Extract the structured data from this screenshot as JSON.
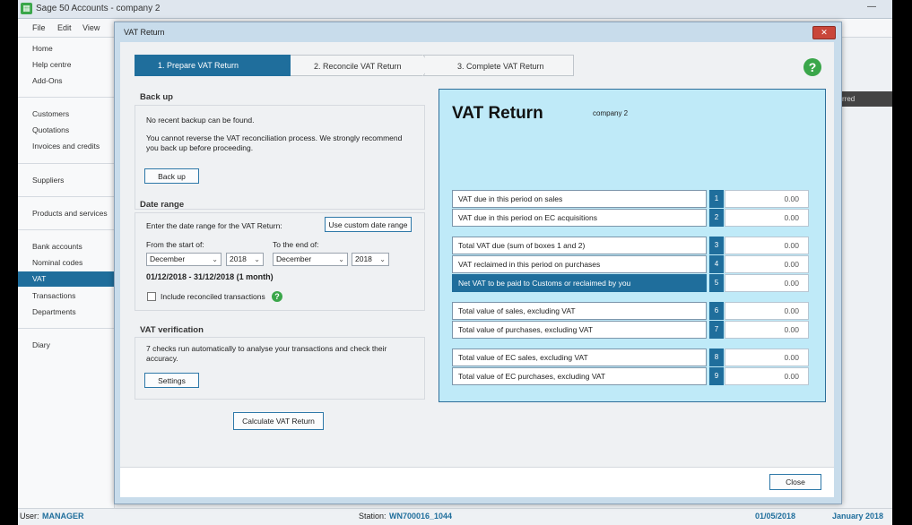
{
  "app": {
    "title": "Sage 50 Accounts - company 2",
    "menu": [
      "File",
      "Edit",
      "View"
    ],
    "nav": [
      {
        "label": "Home",
        "active": false
      },
      {
        "label": "Help centre",
        "active": false
      },
      {
        "label": "Add-Ons",
        "active": false
      },
      {
        "label": "Customers",
        "active": false
      },
      {
        "label": "Quotations",
        "active": false
      },
      {
        "label": "Invoices and credits",
        "active": false
      },
      {
        "label": "Suppliers",
        "active": false
      },
      {
        "label": "Products and services",
        "active": false
      },
      {
        "label": "Bank accounts",
        "active": false
      },
      {
        "label": "Nominal codes",
        "active": false
      },
      {
        "label": "VAT",
        "active": true
      },
      {
        "label": "Transactions",
        "active": false
      },
      {
        "label": "Departments",
        "active": false
      },
      {
        "label": "Diary",
        "active": false
      }
    ],
    "right_strip_text": "rred"
  },
  "status_bar": {
    "user_label": "User:",
    "user_value": "MANAGER",
    "station_label": "Station:",
    "station_value": "WN700016_1044",
    "date": "01/05/2018",
    "period": "January 2018"
  },
  "dialog": {
    "title": "VAT Return",
    "close_glyph": "✕",
    "steps": [
      {
        "label": "1. Prepare VAT Return",
        "active": true
      },
      {
        "label": "2. Reconcile VAT Return",
        "active": false
      },
      {
        "label": "3. Complete VAT Return",
        "active": false
      }
    ],
    "backup": {
      "title": "Back up",
      "line1": "No recent backup can be found.",
      "line2": "You cannot reverse the VAT reconciliation process. We strongly recommend you back up before proceeding.",
      "button": "Back up"
    },
    "date_range": {
      "title": "Date range",
      "prompt": "Enter the date range for the VAT Return:",
      "custom_button": "Use custom date range",
      "from_label": "From the start of:",
      "to_label": "To the end of:",
      "from_month": "December",
      "from_year": "2018",
      "to_month": "December",
      "to_year": "2018",
      "summary": "01/12/2018 - 31/12/2018 (1 month)",
      "include_reconciled_label": "Include reconciled transactions"
    },
    "verification": {
      "title": "VAT verification",
      "text": "7 checks run automatically to analyse your transactions and check their accuracy.",
      "button": "Settings"
    },
    "calculate_button": "Calculate VAT Return",
    "close_button": "Close",
    "vat_return": {
      "heading": "VAT Return",
      "company": "company 2",
      "rows": [
        {
          "num": "1",
          "label": "VAT due in this period on sales",
          "value": "0.00"
        },
        {
          "num": "2",
          "label": "VAT due in this period on EC acquisitions",
          "value": "0.00"
        },
        {
          "num": "3",
          "label": "Total VAT due (sum of boxes 1 and 2)",
          "value": "0.00"
        },
        {
          "num": "4",
          "label": "VAT reclaimed in this period on purchases",
          "value": "0.00"
        },
        {
          "num": "5",
          "label": "Net VAT to be paid to Customs or reclaimed by you",
          "value": "0.00"
        },
        {
          "num": "6",
          "label": "Total value of sales, excluding VAT",
          "value": "0.00"
        },
        {
          "num": "7",
          "label": "Total value of purchases, excluding VAT",
          "value": "0.00"
        },
        {
          "num": "8",
          "label": "Total value of EC sales, excluding VAT",
          "value": "0.00"
        },
        {
          "num": "9",
          "label": "Total value of EC purchases, excluding VAT",
          "value": "0.00"
        }
      ]
    }
  },
  "colors": {
    "accent": "#1f6e9c",
    "panel": "#bfeaf8",
    "help_green": "#3aa64a"
  },
  "icons": {
    "help": "question-circle-icon",
    "close": "close-icon",
    "dropdown": "chevron-down-icon"
  }
}
